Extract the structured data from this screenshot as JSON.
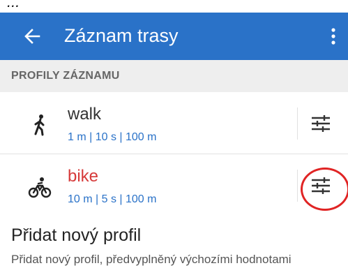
{
  "caption": "...",
  "appbar": {
    "title": "Záznam trasy",
    "back_icon": "arrow-left-icon",
    "overflow_icon": "vertical-dots-icon",
    "color": "#2a72c8"
  },
  "section": {
    "title": "PROFILY ZÁZNAMU"
  },
  "profiles": [
    {
      "name": "walk",
      "values": "1 m | 10 s | 100 m",
      "icon": "walking-person-icon",
      "active": false
    },
    {
      "name": "bike",
      "values": "10 m | 5 s | 100 m",
      "icon": "bicycle-icon",
      "active": true
    }
  ],
  "add_profile": {
    "title": "Přidat nový profil",
    "description": "Přidat nový profil, předvyplněný výchozími hodnotami"
  },
  "colors": {
    "accent": "#2a72c8",
    "active_name": "#d63a3a",
    "highlight_circle": "#e02424"
  }
}
